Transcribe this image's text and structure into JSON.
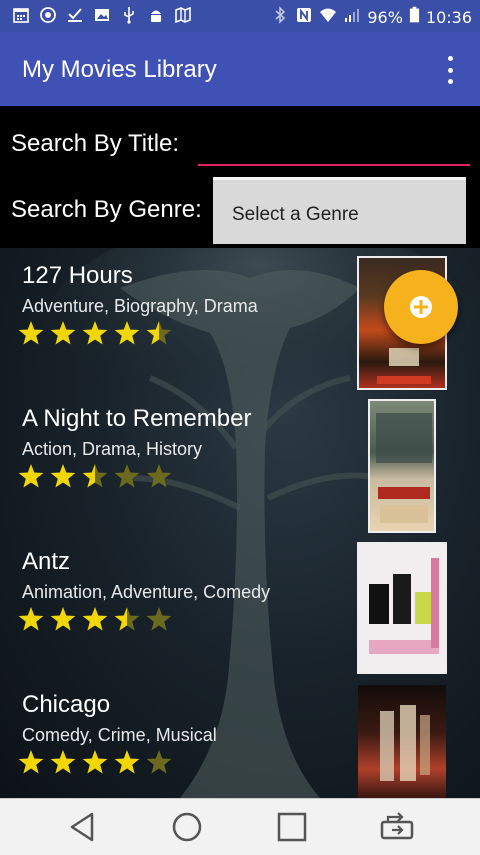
{
  "status_bar": {
    "battery_percent": "96%",
    "time": "10:36",
    "icons": [
      "calendar-icon",
      "vpn-icon",
      "download-done-icon",
      "image-icon",
      "usb-icon",
      "android-debug-icon",
      "map-icon"
    ]
  },
  "app_bar": {
    "title": "My Movies Library",
    "overflow_icon": "more-vert-icon"
  },
  "search": {
    "title_label": "Search By Title:",
    "title_value": "",
    "genre_label": "Search By Genre:",
    "genre_selected": "Select a Genre"
  },
  "movies": [
    {
      "title": "127 Hours",
      "genres": "Adventure, Biography, Drama",
      "rating": 4.5
    },
    {
      "title": "A Night to Remember",
      "genres": "Action, Drama, History",
      "rating": 2.5
    },
    {
      "title": "Antz",
      "genres": "Animation, Adventure, Comedy",
      "rating": 3.5
    },
    {
      "title": "Chicago",
      "genres": "Comedy, Crime, Musical",
      "rating": 4
    }
  ],
  "rating_max": 5,
  "fab": {
    "icon": "add-circle-icon",
    "color": "#f5b21c"
  },
  "colors": {
    "app_bar": "#3f51b5",
    "status_bar": "#3a4fa8",
    "accent": "#e0245e",
    "star_filled": "#f2d600",
    "star_empty": "#6b6a1e"
  },
  "nav_bar": {
    "icons": [
      "back-icon",
      "home-icon",
      "recents-icon",
      "rotate-screen-icon"
    ]
  }
}
